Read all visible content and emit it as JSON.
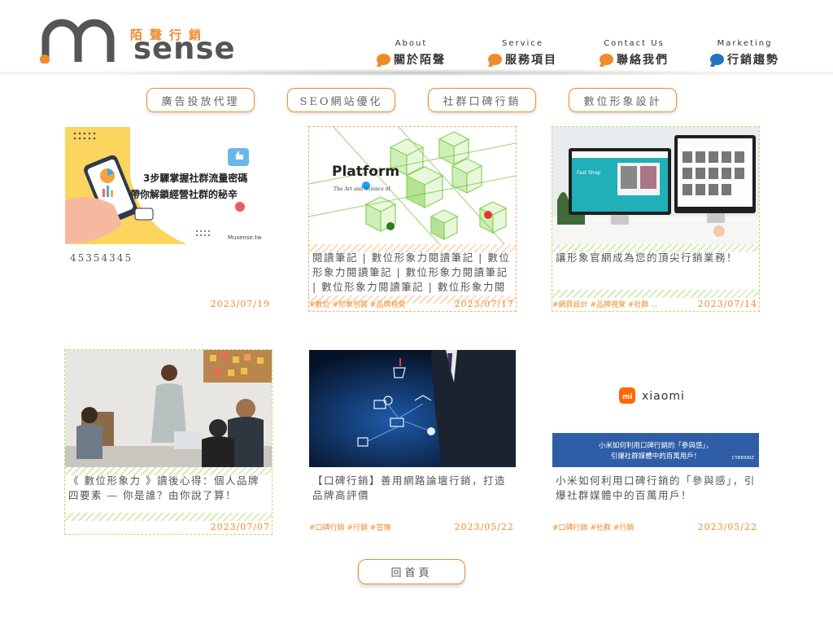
{
  "brand": {
    "name": "Musense",
    "name_tail": "sense",
    "tagline_cn": "陌聲行銷"
  },
  "nav": [
    {
      "en": "About",
      "cn": "關於陌聲",
      "icon": "chat-bubble-orange-icon"
    },
    {
      "en": "Service",
      "cn": "服務項目",
      "icon": "chat-bubble-orange-icon"
    },
    {
      "en": "Contact Us",
      "cn": "聯絡我們",
      "icon": "chat-bubble-orange-icon"
    },
    {
      "en": "Marketing",
      "cn": "行銷趨勢",
      "icon": "chat-bubble-blue-icon"
    }
  ],
  "categories": [
    "廣告投放代理",
    "SEO網站優化",
    "社群口碑行銷",
    "數位形象設計"
  ],
  "cards": [
    {
      "title": "45354345",
      "tags": "",
      "date": "2023/07/19",
      "thumb": {
        "line1": "3步驟掌握社群流量密碼",
        "line2": "帶你解鎖經營社群的秘辛",
        "site": "Musense.tw"
      }
    },
    {
      "title": "閱讀筆記 | 數位形象力閱讀筆記 | 數位形象力閱讀筆記 | 數位形象力閱讀筆記 | 數位形象力閱讀筆記 | 數位形象力閱讀筆記",
      "tags": "#數位 #形象包裝 #品牌視覺",
      "date": "2023/07/17",
      "thumb": {
        "word": "Platform",
        "side": "The Art and Science of"
      }
    },
    {
      "title": "讓形象官網成為您的頂尖行銷業務！",
      "tags": "#網頁設計 #品牌視覺 #社群 ...",
      "date": "2023/07/14",
      "thumb": {
        "screen": "Fast Shop"
      }
    },
    {
      "title": "《 數位形象力 》讀後心得：個人品牌四要素 — 你是誰？由你說了算！",
      "tags": "",
      "date": "2023/07/07"
    },
    {
      "title": "【口碑行銷】善用網路論壇行銷，打造品牌高評價",
      "tags": "#口碑行銷 #行銷 #宣傳",
      "date": "2023/05/22"
    },
    {
      "title": "小米如何利用口碑行銷的「參與感」，引爆社群媒體中的百萬用戶！",
      "tags": "#口碑行銷 #社群 #行銷",
      "date": "2023/05/22",
      "thumb": {
        "logo": "xiaomi",
        "mi": "mi",
        "banner1": "小米如何利用口碑行銷的「參與感」，",
        "banner2": "引爆社群媒體中的百萬用戶！",
        "credit": "CYBERBIZ"
      }
    }
  ],
  "home_button": "回首頁",
  "colors": {
    "accent": "#f08a2c",
    "blue": "#2672c4",
    "text": "#555555"
  }
}
